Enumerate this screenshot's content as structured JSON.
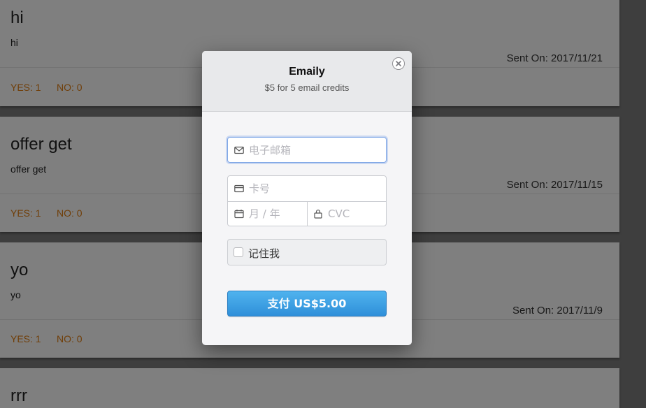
{
  "posts": [
    {
      "title": "hi",
      "body": "hi",
      "sent_on": "Sent On: 2017/11/21",
      "yes": "YES: 1",
      "no": "NO: 0"
    },
    {
      "title": "offer get",
      "body": "offer get",
      "sent_on": "Sent On: 2017/11/15",
      "yes": "YES: 1",
      "no": "NO: 0"
    },
    {
      "title": "yo",
      "body": "yo",
      "sent_on": "Sent On: 2017/11/9",
      "yes": "YES: 1",
      "no": "NO: 0"
    },
    {
      "title": "rrr"
    }
  ],
  "checkout": {
    "title": "Emaily",
    "subtitle": "$5 for 5 email credits",
    "email_placeholder": "电子邮箱",
    "card_number_placeholder": "卡号",
    "expiry_placeholder": "月 / 年",
    "cvc_placeholder": "CVC",
    "remember_label": "记住我",
    "pay_label": "支付 US$5.00",
    "accent_color": "#3a9fe4"
  },
  "icons": {
    "close": "close-icon",
    "email": "envelope-icon",
    "card": "credit-card-icon",
    "expiry": "calendar-icon",
    "cvc": "lock-icon"
  }
}
